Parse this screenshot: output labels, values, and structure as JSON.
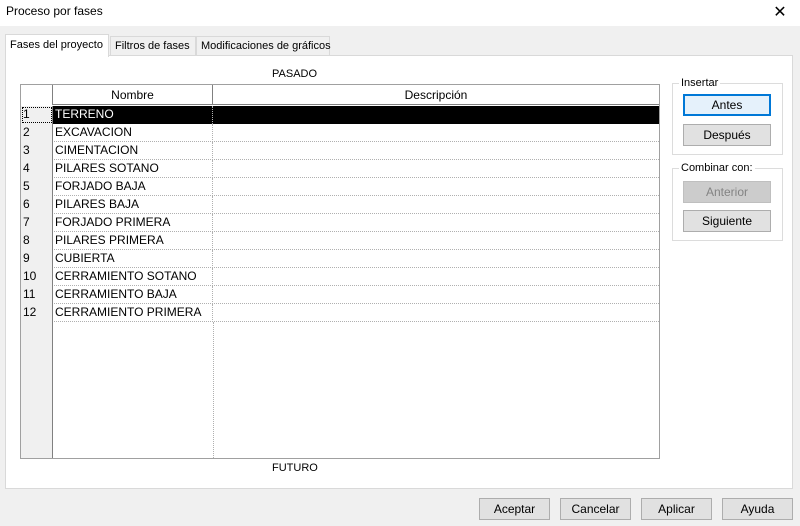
{
  "window": {
    "title": "Proceso por fases",
    "close_glyph": "✕"
  },
  "tabs": [
    {
      "label": "Fases del proyecto",
      "active": true
    },
    {
      "label": "Filtros de fases",
      "active": false
    },
    {
      "label": "Modificaciones de gráficos",
      "active": false
    }
  ],
  "phases_panel": {
    "past_label": "PASADO",
    "future_label": "FUTURO",
    "columns": {
      "name": "Nombre",
      "description": "Descripción"
    },
    "rows": [
      {
        "num": "1",
        "name": "TERRENO",
        "description": "",
        "selected": true
      },
      {
        "num": "2",
        "name": "EXCAVACION",
        "description": ""
      },
      {
        "num": "3",
        "name": "CIMENTACION",
        "description": ""
      },
      {
        "num": "4",
        "name": "PILARES SOTANO",
        "description": ""
      },
      {
        "num": "5",
        "name": "FORJADO BAJA",
        "description": ""
      },
      {
        "num": "6",
        "name": "PILARES BAJA",
        "description": ""
      },
      {
        "num": "7",
        "name": "FORJADO PRIMERA",
        "description": ""
      },
      {
        "num": "8",
        "name": "PILARES PRIMERA",
        "description": ""
      },
      {
        "num": "9",
        "name": "CUBIERTA",
        "description": ""
      },
      {
        "num": "10",
        "name": "CERRAMIENTO SOTANO",
        "description": ""
      },
      {
        "num": "11",
        "name": "CERRAMIENTO BAJA",
        "description": ""
      },
      {
        "num": "12",
        "name": "CERRAMIENTO PRIMERA",
        "description": ""
      }
    ]
  },
  "insert_group": {
    "title": "Insertar",
    "before_label": "Antes",
    "after_label": "Después"
  },
  "combine_group": {
    "title": "Combinar con:",
    "previous_label": "Anterior",
    "next_label": "Siguiente"
  },
  "footer": {
    "ok_label": "Aceptar",
    "cancel_label": "Cancelar",
    "apply_label": "Aplicar",
    "help_label": "Ayuda"
  },
  "colors": {
    "accent": "#0078d7",
    "selection": "#000000"
  }
}
